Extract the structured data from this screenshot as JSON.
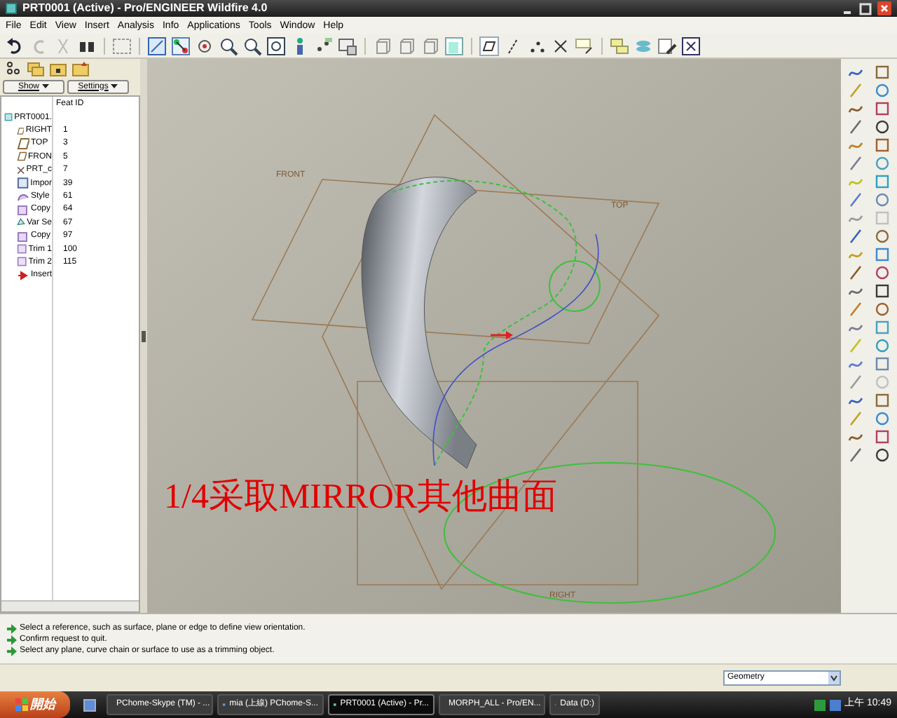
{
  "window": {
    "title": "PRT0001 (Active) - Pro/ENGINEER Wildfire 4.0"
  },
  "menu": [
    "File",
    "Edit",
    "View",
    "Insert",
    "Analysis",
    "Info",
    "Applications",
    "Tools",
    "Window",
    "Help"
  ],
  "model_tree": {
    "buttons": [
      "Show",
      "Settings"
    ],
    "column": "Feat ID",
    "root": {
      "label": "PRT0001.",
      "children": [
        {
          "kind": "datum_plane",
          "label": "RIGHT",
          "feat_id": "1"
        },
        {
          "kind": "datum_plane",
          "label": "TOP",
          "feat_id": "3"
        },
        {
          "kind": "datum_plane",
          "label": "FRON",
          "feat_id": "5"
        },
        {
          "kind": "csys",
          "label": "PRT_c",
          "feat_id": "7"
        },
        {
          "kind": "import",
          "label": "Impor",
          "feat_id": "39"
        },
        {
          "kind": "style",
          "label": "Style",
          "feat_id": "61"
        },
        {
          "kind": "copy",
          "label": "Copy",
          "feat_id": "64"
        },
        {
          "kind": "var",
          "label": "Var Se",
          "feat_id": "67"
        },
        {
          "kind": "copy",
          "label": "Copy",
          "feat_id": "97"
        },
        {
          "kind": "trim",
          "label": "Trim 1",
          "feat_id": "100"
        },
        {
          "kind": "trim",
          "label": "Trim 2",
          "feat_id": "115"
        },
        {
          "kind": "insert",
          "label": "Insert"
        }
      ]
    }
  },
  "graphics": {
    "plane_labels": [
      "FRONT",
      "TOP",
      "RIGHT"
    ],
    "caption": "1/4采取MIRROR其他曲面"
  },
  "messages": [
    "Select a reference, such as surface, plane or edge to define view orientation.",
    "Confirm request to quit.",
    "Select any plane, curve chain or surface to use as a trimming object."
  ],
  "status": {
    "filter": "Geometry"
  },
  "taskbar": {
    "start": "開始",
    "tasks": [
      {
        "label": "PChome-Skype (TM) - ...",
        "selected": false
      },
      {
        "label": "mia (上線) PChome-S...",
        "selected": false
      },
      {
        "label": "PRT0001 (Active) - Pr...",
        "selected": true
      },
      {
        "label": "MORPH_ALL - Pro/EN...",
        "selected": false
      },
      {
        "label": "Data (D:)",
        "selected": false
      }
    ],
    "clock": "上午 10:49"
  }
}
